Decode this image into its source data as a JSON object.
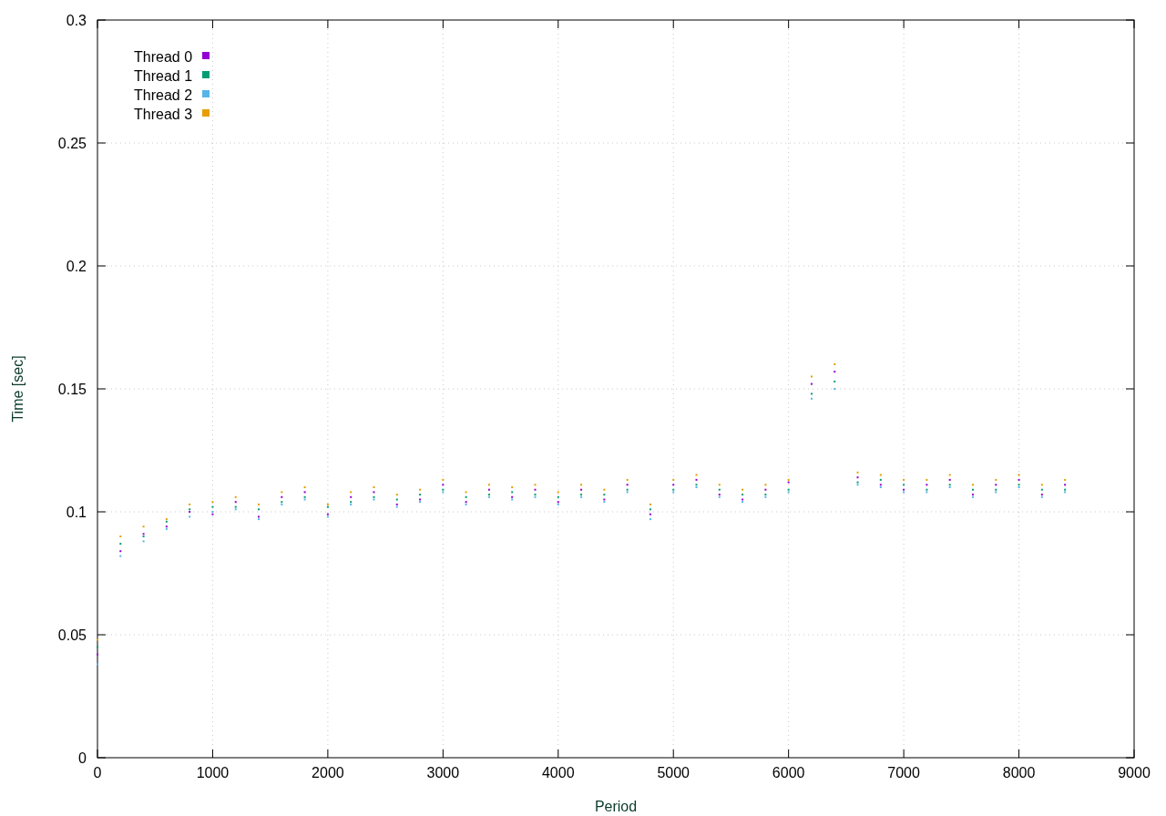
{
  "chart_data": {
    "type": "scatter",
    "xlabel": "Period",
    "ylabel": "Time [sec]",
    "x": [
      0,
      200,
      400,
      600,
      800,
      1000,
      1200,
      1400,
      1600,
      1800,
      2000,
      2200,
      2400,
      2600,
      2800,
      3000,
      3200,
      3400,
      3600,
      3800,
      4000,
      4200,
      4400,
      4600,
      4800,
      5000,
      5200,
      5400,
      5600,
      5800,
      6000,
      6200,
      6400,
      6600,
      6800,
      7000,
      7200,
      7400,
      7600,
      7800,
      8000,
      8200,
      8400
    ],
    "series": [
      {
        "name": "Thread 0",
        "color": "#9400d3",
        "values": [
          0.042,
          0.084,
          0.091,
          0.094,
          0.1,
          0.099,
          0.104,
          0.098,
          0.106,
          0.108,
          0.099,
          0.106,
          0.108,
          0.103,
          0.105,
          0.111,
          0.104,
          0.109,
          0.106,
          0.109,
          0.104,
          0.109,
          0.105,
          0.111,
          0.099,
          0.111,
          0.113,
          0.107,
          0.105,
          0.109,
          0.112,
          0.152,
          0.157,
          0.114,
          0.111,
          0.109,
          0.111,
          0.113,
          0.107,
          0.111,
          0.113,
          0.107,
          0.111
        ]
      },
      {
        "name": "Thread 1",
        "color": "#009e73",
        "values": [
          0.045,
          0.087,
          0.09,
          0.096,
          0.101,
          0.102,
          0.102,
          0.101,
          0.104,
          0.106,
          0.102,
          0.104,
          0.106,
          0.105,
          0.107,
          0.109,
          0.106,
          0.107,
          0.108,
          0.107,
          0.106,
          0.107,
          0.107,
          0.109,
          0.101,
          0.109,
          0.111,
          0.109,
          0.107,
          0.107,
          0.109,
          0.148,
          0.153,
          0.112,
          0.113,
          0.111,
          0.109,
          0.111,
          0.109,
          0.109,
          0.111,
          0.109,
          0.109
        ]
      },
      {
        "name": "Thread 2",
        "color": "#56b4e9",
        "values": [
          0.038,
          0.082,
          0.088,
          0.093,
          0.098,
          0.1,
          0.101,
          0.097,
          0.103,
          0.105,
          0.098,
          0.103,
          0.105,
          0.102,
          0.104,
          0.108,
          0.103,
          0.106,
          0.105,
          0.106,
          0.103,
          0.106,
          0.104,
          0.108,
          0.097,
          0.108,
          0.11,
          0.106,
          0.104,
          0.106,
          0.108,
          0.146,
          0.15,
          0.111,
          0.11,
          0.108,
          0.108,
          0.11,
          0.106,
          0.108,
          0.11,
          0.106,
          0.108
        ]
      },
      {
        "name": "Thread 3",
        "color": "#e69f00",
        "values": [
          0.048,
          0.09,
          0.094,
          0.097,
          0.103,
          0.104,
          0.106,
          0.103,
          0.108,
          0.11,
          0.103,
          0.108,
          0.11,
          0.107,
          0.109,
          0.113,
          0.108,
          0.111,
          0.11,
          0.111,
          0.108,
          0.111,
          0.109,
          0.113,
          0.103,
          0.113,
          0.115,
          0.111,
          0.109,
          0.111,
          0.113,
          0.155,
          0.16,
          0.116,
          0.115,
          0.113,
          0.113,
          0.115,
          0.111,
          0.113,
          0.115,
          0.111,
          0.113
        ]
      }
    ],
    "xlim": [
      0,
      9000
    ],
    "ylim": [
      0,
      0.3
    ],
    "xticks": [
      0,
      1000,
      2000,
      3000,
      4000,
      5000,
      6000,
      7000,
      8000,
      9000
    ],
    "yticks": [
      0,
      0.05,
      0.1,
      0.15,
      0.2,
      0.25,
      0.3
    ],
    "grid": true,
    "legend": "upper left"
  }
}
